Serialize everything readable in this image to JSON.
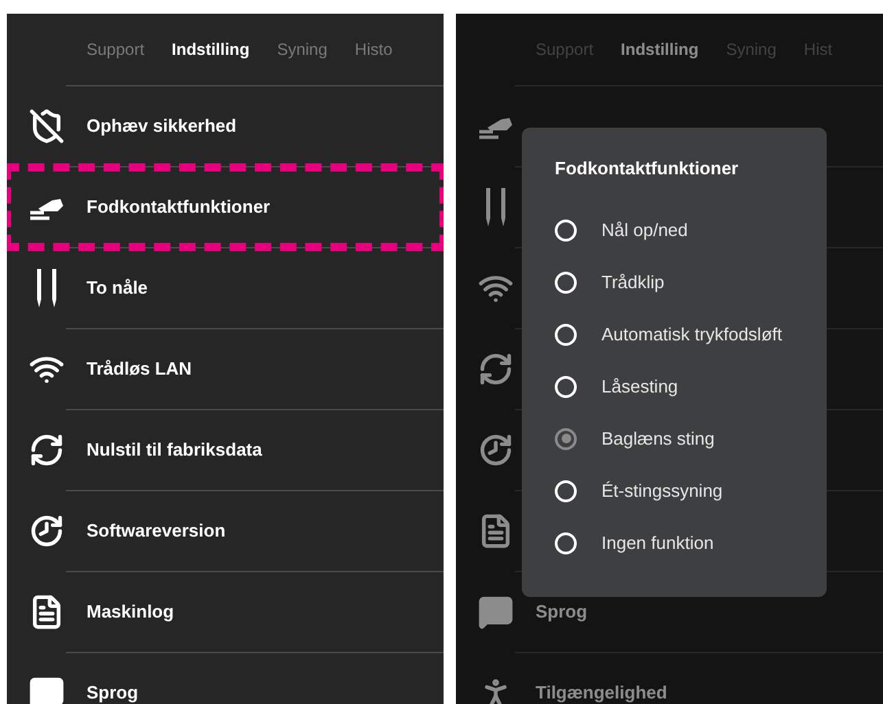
{
  "panels": [
    {
      "tabs": [
        {
          "label": "Support",
          "selected": false
        },
        {
          "label": "Indstilling",
          "selected": true
        },
        {
          "label": "Syning",
          "selected": false
        },
        {
          "label": "Histo",
          "selected": false
        }
      ],
      "dimmed": false,
      "items": [
        {
          "kind": "shield-off",
          "label": "Ophæv sikkerhed",
          "highlighted": false
        },
        {
          "kind": "pedal",
          "label": "Fodkontaktfunktioner",
          "highlighted": true
        },
        {
          "kind": "needles",
          "label": "To nåle",
          "highlighted": false
        },
        {
          "kind": "wifi",
          "label": "Trådløs LAN",
          "highlighted": false
        },
        {
          "kind": "reset",
          "label": "Nulstil til fabriksdata",
          "highlighted": false
        },
        {
          "kind": "clock",
          "label": "Softwareversion",
          "highlighted": false
        },
        {
          "kind": "document",
          "label": "Maskinlog",
          "highlighted": false
        },
        {
          "kind": "speech",
          "label": "Sprog",
          "highlighted": false
        }
      ]
    },
    {
      "tabs": [
        {
          "label": "Support",
          "selected": false
        },
        {
          "label": "Indstilling",
          "selected": true
        },
        {
          "label": "Syning",
          "selected": false
        },
        {
          "label": "Hist",
          "selected": false
        }
      ],
      "dimmed": true,
      "items": [
        {
          "kind": "pedal",
          "highlighted": false
        },
        {
          "kind": "needles",
          "highlighted": false
        },
        {
          "kind": "wifi",
          "highlighted": false
        },
        {
          "kind": "reset",
          "highlighted": false
        },
        {
          "kind": "clock",
          "highlighted": false
        },
        {
          "kind": "document",
          "highlighted": false
        },
        {
          "kind": "speech",
          "label": "Sprog",
          "highlighted": false
        },
        {
          "kind": "person",
          "label": "Tilgængelighed",
          "highlighted": false
        }
      ],
      "dialog": {
        "title": "Fodkontaktfunktioner",
        "options": [
          {
            "label": "Nål op/ned",
            "selected": false
          },
          {
            "label": "Trådklip",
            "selected": false
          },
          {
            "label": "Automatisk trykfodsløft",
            "selected": false
          },
          {
            "label": "Låsesting",
            "selected": false
          },
          {
            "label": "Baglæns sting",
            "selected": true
          },
          {
            "label": "Ét-stingssyning",
            "selected": false
          },
          {
            "label": "Ingen funktion",
            "selected": false
          }
        ]
      }
    }
  ]
}
